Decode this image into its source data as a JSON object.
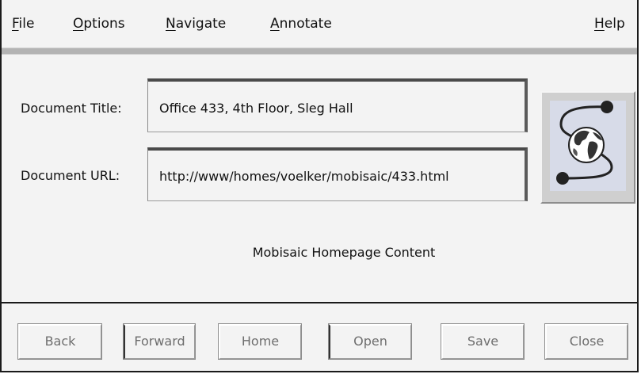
{
  "menubar": {
    "file": {
      "first": "F",
      "rest": "ile"
    },
    "options": {
      "first": "O",
      "rest": "ptions"
    },
    "navigate": {
      "first": "N",
      "rest": "avigate"
    },
    "annotate": {
      "first": "A",
      "rest": "nnotate"
    },
    "help": {
      "first": "H",
      "rest": "elp"
    }
  },
  "document": {
    "title_label": "Document Title:",
    "title_value": "Office 433, 4th Floor, Sleg Hall",
    "url_label": "Document URL:",
    "url_value": "http://www/homes/voelker/mobisaic/433.html"
  },
  "logo": {
    "icon": "globe-icon"
  },
  "content": {
    "caption": "Mobisaic Homepage Content"
  },
  "buttons": {
    "back": "Back",
    "forward": "Forward",
    "home": "Home",
    "open": "Open",
    "save": "Save",
    "close": "Close"
  }
}
